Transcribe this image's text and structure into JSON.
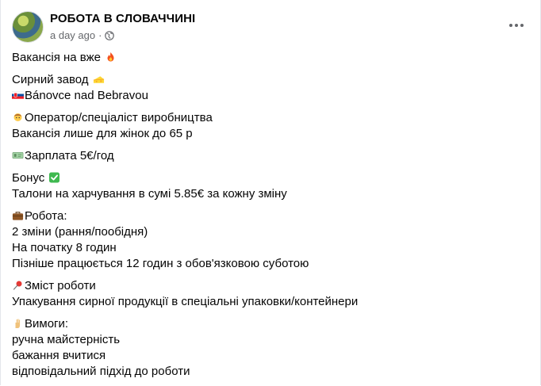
{
  "post": {
    "group_name": "РОБОТА В СЛОВАЧЧИНІ",
    "time": "a day ago",
    "separator": "·"
  },
  "icons": {
    "avatar": "group-avatar",
    "privacy": "globe-icon",
    "more": "more-options-icon"
  },
  "content": {
    "p1": {
      "text": "Вакансія на вже",
      "emoji": "fire"
    },
    "p2": {
      "line1": "Сирний завод",
      "line1_emoji": "cheese",
      "line2": "Bánovce nad Bebravou",
      "line2_emoji": "slovakia-flag"
    },
    "p3": {
      "line1": "Оператор/спеціаліст виробництва",
      "line1_emoji": "woman-worker",
      "line2": "Вакансія лише для жінок до 65 р"
    },
    "p4": {
      "line1": "Зарплата  5€/год",
      "line1_emoji": "money"
    },
    "p5": {
      "line1": "Бонус",
      "line1_emoji": "check-mark",
      "line2": "Талони на харчування в сумі 5.85€ за кожну зміну"
    },
    "p6": {
      "line1": "Робота:",
      "line1_emoji": "briefcase",
      "line2": "2 зміни (рання/пообідня)",
      "line3": "На початку 8 годин",
      "line4": "Пізніше працюється 12 годин з обов'язковою суботою"
    },
    "p7": {
      "line1": "Зміст роботи",
      "line1_emoji": "pushpin",
      "line2": "Упакування сирної продукції в спеціальні упаковки/контейнери"
    },
    "p8": {
      "line1": "Вимоги:",
      "line1_emoji": "hand",
      "line2": "ручна майстерність",
      "line3": "бажання вчитися",
      "line4": "відповідальний підхід до роботи"
    }
  }
}
